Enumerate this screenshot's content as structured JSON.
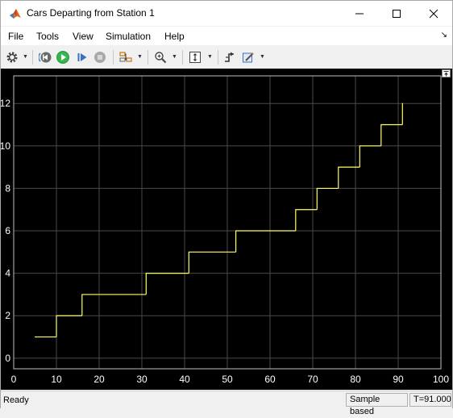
{
  "window": {
    "title": "Cars Departing from Station 1",
    "controls": [
      "minimize-icon",
      "maximize-icon",
      "close-icon"
    ]
  },
  "menu": {
    "items": [
      "File",
      "Tools",
      "View",
      "Simulation",
      "Help"
    ]
  },
  "toolbar": {
    "icons": [
      "gear-icon",
      "step-back-icon",
      "run-icon",
      "step-forward-icon",
      "stop-icon",
      "signal-layout-icon",
      "zoom-icon",
      "autoscale-icon",
      "trigger-icon",
      "highlight-icon"
    ]
  },
  "chart_data": {
    "type": "line",
    "background": "#000000",
    "line_color": "#ffff66",
    "axis_color": "#ffffff",
    "grid": true,
    "xlim": [
      0,
      100
    ],
    "ylim": [
      -0.5,
      13.3
    ],
    "xticks": [
      "0",
      "10",
      "20",
      "30",
      "40",
      "50",
      "60",
      "70",
      "80",
      "90",
      "100"
    ],
    "yticks": [
      "0",
      "2",
      "4",
      "6",
      "8",
      "10",
      "12"
    ],
    "series": [
      {
        "step": true,
        "x": [
          5,
          10,
          16,
          31,
          41,
          52,
          66,
          71,
          76,
          81,
          86,
          91
        ],
        "y": [
          1,
          2,
          3,
          4,
          5,
          6,
          7,
          8,
          9,
          10,
          11,
          12
        ]
      }
    ]
  },
  "status": {
    "ready": "Ready",
    "mode": "Sample based",
    "time": "T=91.000"
  }
}
